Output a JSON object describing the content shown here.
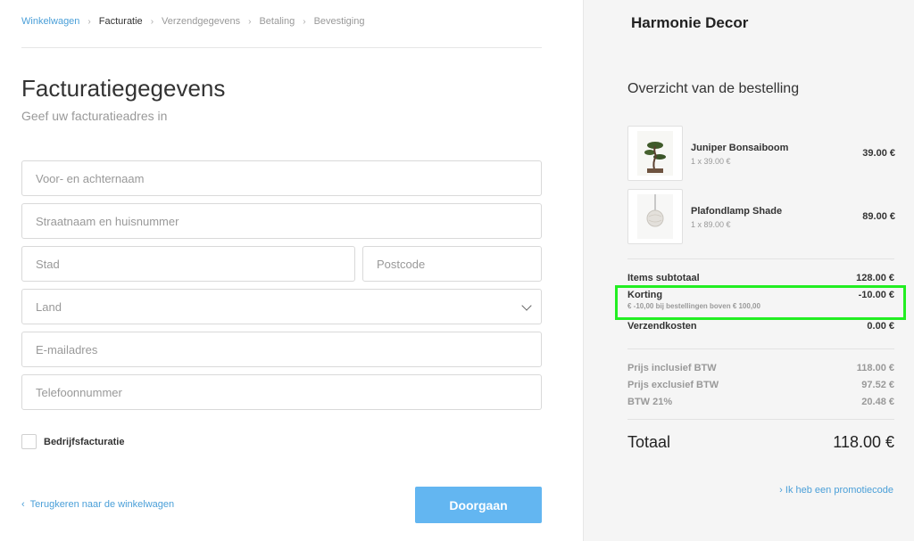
{
  "breadcrumb": [
    "Winkelwagen",
    "Facturatie",
    "Verzendgegevens",
    "Betaling",
    "Bevestiging"
  ],
  "form": {
    "title": "Facturatiegegevens",
    "subtitle": "Geef uw facturatieadres in",
    "name_placeholder": "Voor- en achternaam",
    "street_placeholder": "Straatnaam en huisnummer",
    "city_placeholder": "Stad",
    "postcode_placeholder": "Postcode",
    "country_select": "Land",
    "email_placeholder": "E-mailadres",
    "phone_placeholder": "Telefoonnummer",
    "business_checkbox_label": "Bedrijfsfacturatie",
    "back_link": "Terugkeren naar de winkelwagen",
    "continue_button": "Doorgaan"
  },
  "summary": {
    "brand": "Harmonie Decor",
    "title": "Overzicht van de bestelling",
    "items": [
      {
        "name": "Juniper Bonsaiboom",
        "qty": "1 x 39.00 €",
        "price": "39.00 €",
        "icon": "bonsai-image"
      },
      {
        "name": "Plafondlamp Shade",
        "qty": "1 x 89.00 €",
        "price": "89.00 €",
        "icon": "pendant-lamp-image"
      }
    ],
    "subtotal_label": "Items subtotaal",
    "subtotal_value": "128.00 €",
    "discount_label": "Korting",
    "discount_value": "-10.00 €",
    "discount_note": "€ -10,00 bij bestellingen boven € 100,00",
    "shipping_label": "Verzendkosten",
    "shipping_value": "0.00 €",
    "incl_label": "Prijs inclusief BTW",
    "incl_value": "118.00 €",
    "excl_label": "Prijs exclusief BTW",
    "excl_value": "97.52 €",
    "vat_label": "BTW 21%",
    "vat_value": "20.48 €",
    "total_label": "Totaal",
    "total_value": "118.00 €",
    "promo_link": "Ik heb een promotiecode"
  },
  "colors": {
    "accent": "#4a9fd8",
    "button": "#63b6f1",
    "highlight": "#22ee22",
    "panel": "#f5f5f5"
  }
}
